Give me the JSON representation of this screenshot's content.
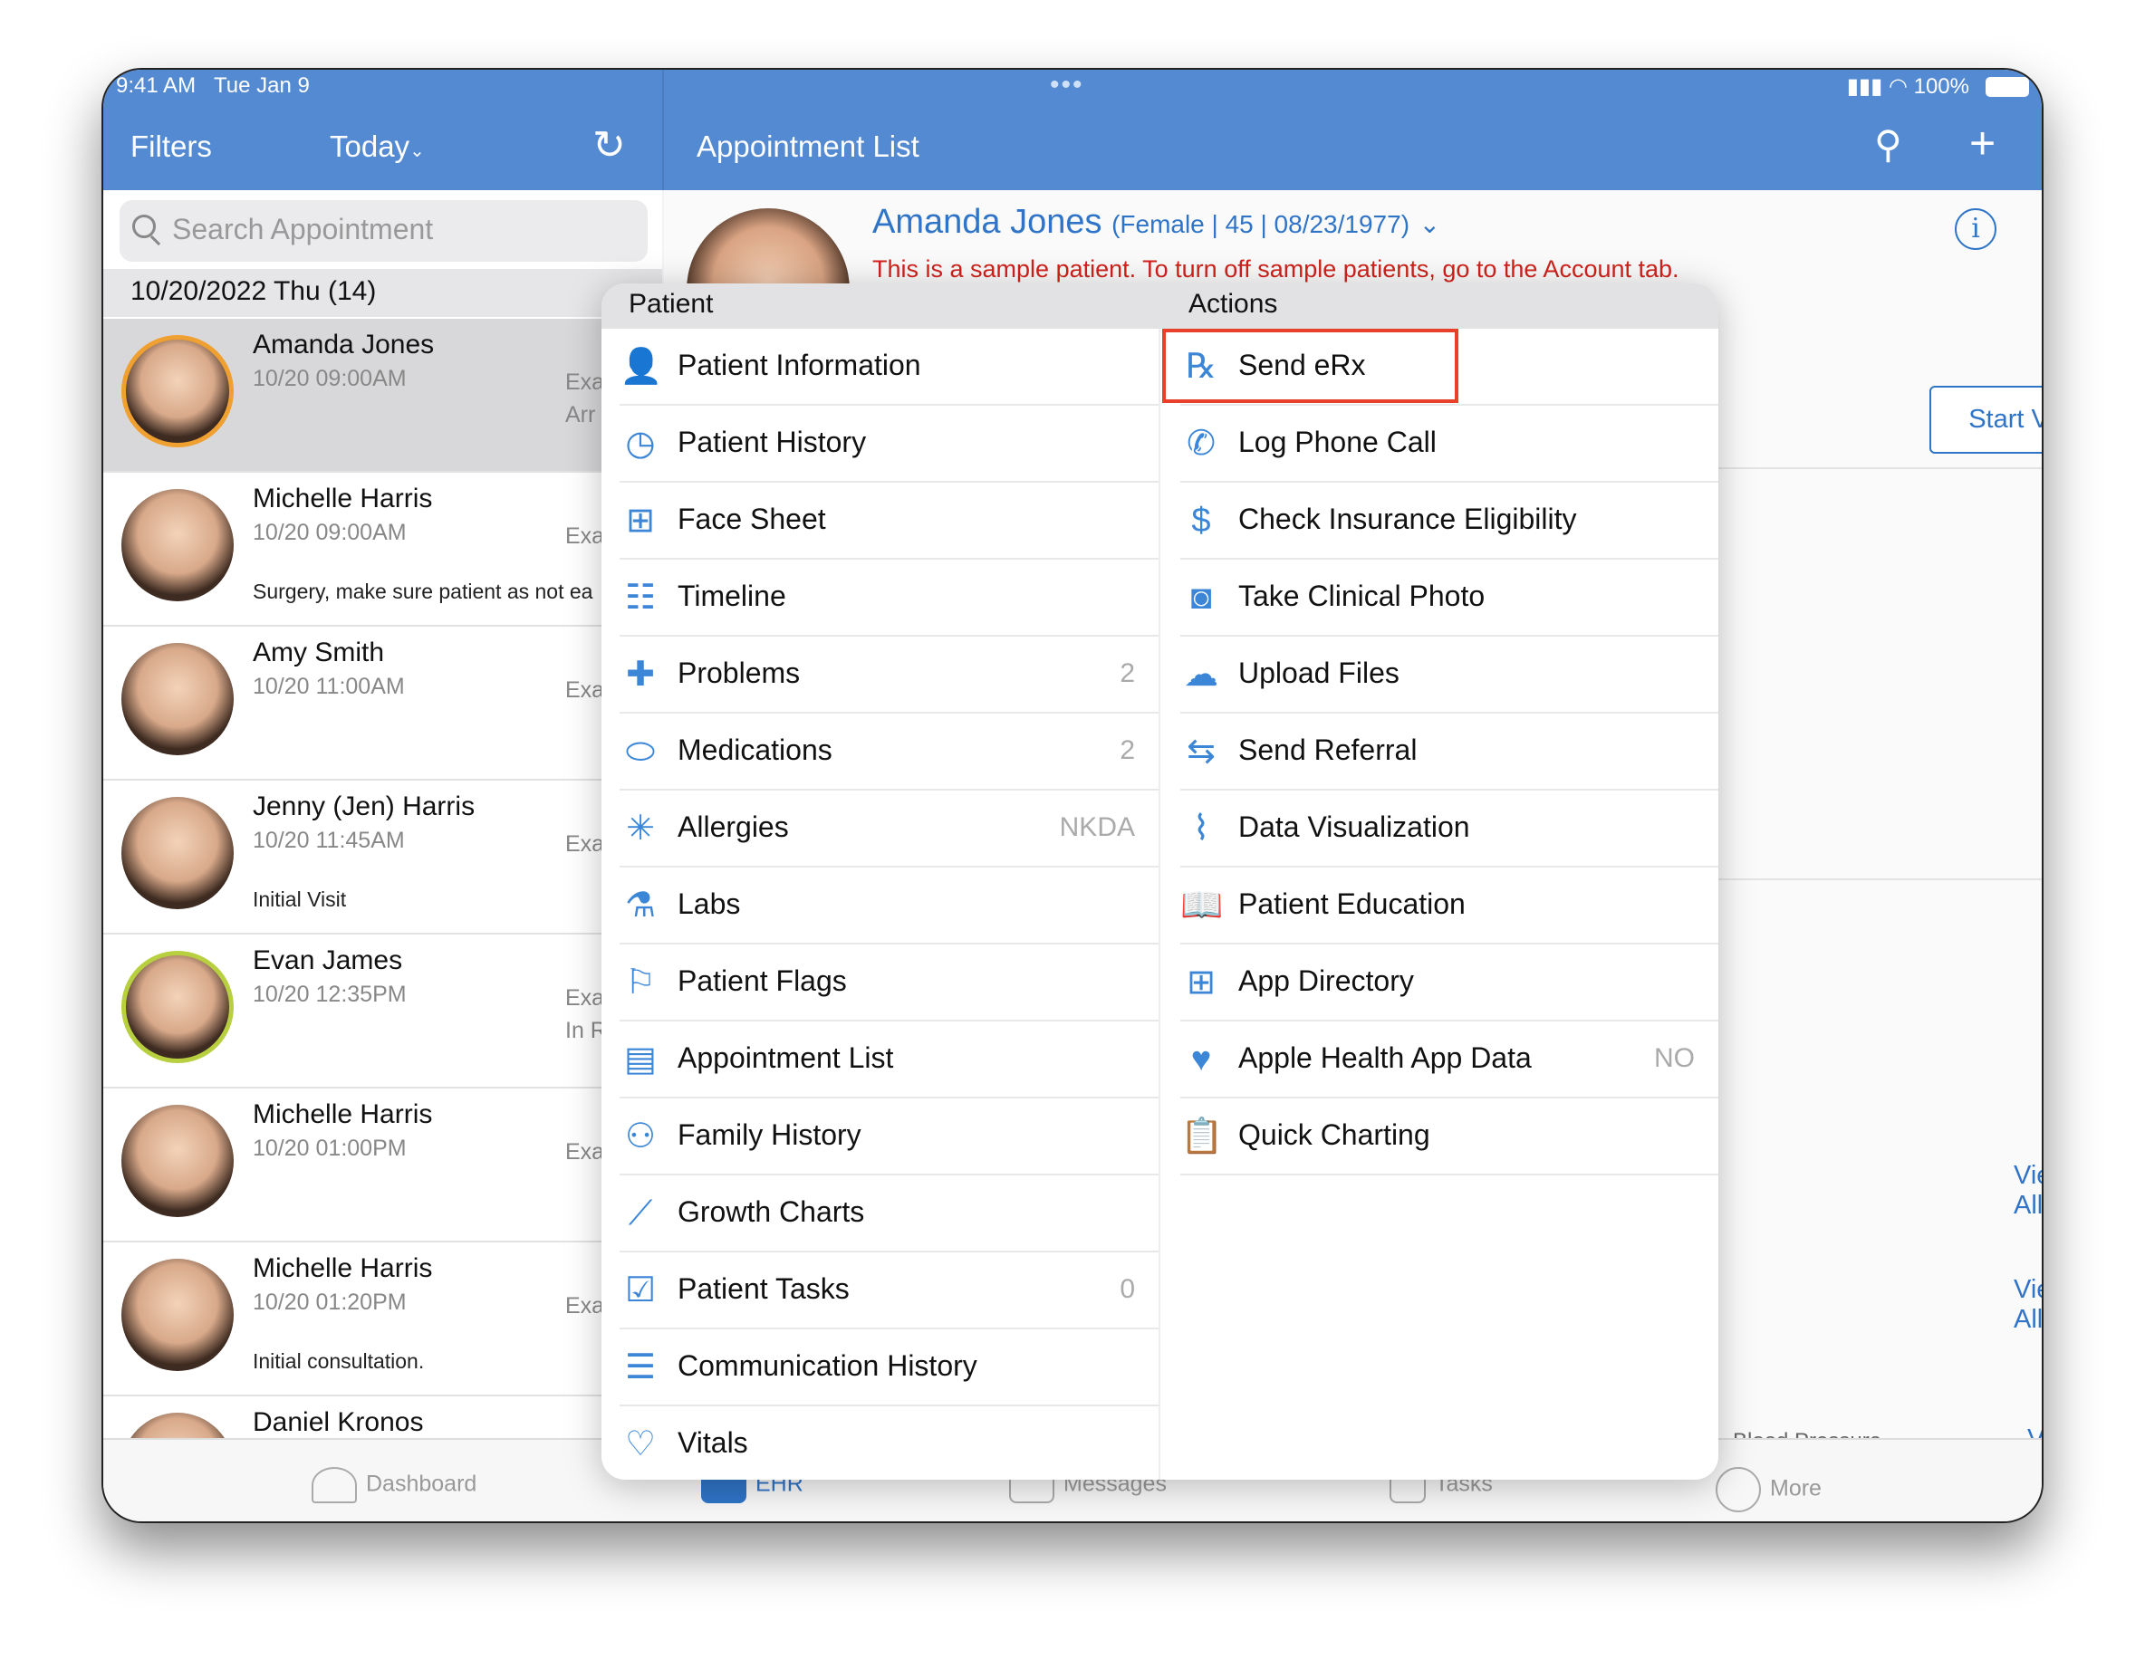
{
  "status": {
    "time": "9:41 AM",
    "date": "Tue Jan 9",
    "battery": "100%",
    "multitask_icon": "ellipsis-icon"
  },
  "left_nav": {
    "filters": "Filters",
    "today": "Today",
    "refresh_icon": "refresh-icon"
  },
  "right_nav": {
    "title": "Appointment List",
    "search_icon": "search-icon",
    "add_icon": "plus-icon"
  },
  "search": {
    "placeholder": "Search Appointment"
  },
  "date_header": "10/20/2022 Thu (14)",
  "appointments": [
    {
      "name": "Amanda Jones",
      "time": "10/20 09:00AM",
      "type": "Exa",
      "status": "Arr",
      "note": "",
      "ring": "#f0a030",
      "selected": true
    },
    {
      "name": "Michelle Harris",
      "time": "10/20 09:00AM",
      "type": "Exa",
      "status": "",
      "note": "Surgery, make sure patient as not ea"
    },
    {
      "name": "Amy Smith",
      "time": "10/20 11:00AM",
      "type": "Exa",
      "status": "",
      "note": ""
    },
    {
      "name": "Jenny (Jen) Harris",
      "time": "10/20 11:45AM",
      "type": "Exa",
      "status": "",
      "note": "Initial Visit"
    },
    {
      "name": "Evan James",
      "time": "10/20 12:35PM",
      "type": "Exa",
      "status": "In R",
      "note": "",
      "ring": "#b8d040"
    },
    {
      "name": "Michelle Harris",
      "time": "10/20 01:00PM",
      "type": "Exa",
      "status": "",
      "note": ""
    },
    {
      "name": "Michelle Harris",
      "time": "10/20 01:20PM",
      "type": "Exa",
      "status": "",
      "note": "Initial consultation."
    },
    {
      "name": "Daniel Kronos",
      "time": "",
      "type": "",
      "status": "",
      "note": ""
    }
  ],
  "patient": {
    "name": "Amanda Jones",
    "details": "(Female | 45 | 08/23/1977)",
    "warning": "This is a sample patient. To turn off sample patients, go to the Account tab.",
    "start_visit": "Start Visit"
  },
  "view_all": [
    "View All",
    "View All",
    "View All"
  ],
  "blood_pressure": "Blood Pressure",
  "popover": {
    "patient_header": "Patient",
    "actions_header": "Actions",
    "patient_items": [
      {
        "label": "Patient Information",
        "icon": "person-icon",
        "g": "👤",
        "badge": ""
      },
      {
        "label": "Patient History",
        "icon": "history-icon",
        "g": "◷",
        "badge": ""
      },
      {
        "label": "Face Sheet",
        "icon": "grid-icon",
        "g": "⊞",
        "badge": ""
      },
      {
        "label": "Timeline",
        "icon": "timeline-icon",
        "g": "☷",
        "badge": ""
      },
      {
        "label": "Problems",
        "icon": "medical-cross-icon",
        "g": "✚",
        "badge": "2"
      },
      {
        "label": "Medications",
        "icon": "pill-icon",
        "g": "⬭",
        "badge": "2"
      },
      {
        "label": "Allergies",
        "icon": "asterisk-icon",
        "g": "✳",
        "badge": "NKDA"
      },
      {
        "label": "Labs",
        "icon": "flask-icon",
        "g": "⚗",
        "badge": ""
      },
      {
        "label": "Patient Flags",
        "icon": "flag-icon",
        "g": "⚐",
        "badge": ""
      },
      {
        "label": "Appointment List",
        "icon": "calendar-clock-icon",
        "g": "▤",
        "badge": ""
      },
      {
        "label": "Family History",
        "icon": "family-tree-icon",
        "g": "⚇",
        "badge": ""
      },
      {
        "label": "Growth Charts",
        "icon": "chart-icon",
        "g": "⟋",
        "badge": ""
      },
      {
        "label": "Patient Tasks",
        "icon": "checklist-icon",
        "g": "☑",
        "badge": "0"
      },
      {
        "label": "Communication History",
        "icon": "chat-icon",
        "g": "☰",
        "badge": ""
      },
      {
        "label": "Vitals",
        "icon": "heart-pulse-icon",
        "g": "♡",
        "badge": ""
      }
    ],
    "action_items": [
      {
        "label": "Send eRx",
        "icon": "rx-icon",
        "g": "℞",
        "badge": ""
      },
      {
        "label": "Log Phone Call",
        "icon": "phone-icon",
        "g": "✆",
        "badge": ""
      },
      {
        "label": "Check Insurance Eligibility",
        "icon": "dollar-icon",
        "g": "$",
        "badge": ""
      },
      {
        "label": "Take Clinical Photo",
        "icon": "camera-icon",
        "g": "◙",
        "badge": ""
      },
      {
        "label": "Upload Files",
        "icon": "cloud-upload-icon",
        "g": "☁",
        "badge": ""
      },
      {
        "label": "Send Referral",
        "icon": "referral-icon",
        "g": "⇆",
        "badge": ""
      },
      {
        "label": "Data Visualization",
        "icon": "line-chart-icon",
        "g": "⌇",
        "badge": ""
      },
      {
        "label": "Patient Education",
        "icon": "book-icon",
        "g": "📖",
        "badge": ""
      },
      {
        "label": "App Directory",
        "icon": "apps-grid-icon",
        "g": "⊞",
        "badge": ""
      },
      {
        "label": "Apple Health App Data",
        "icon": "health-heart-icon",
        "g": "♥",
        "badge": "NO"
      },
      {
        "label": "Quick Charting",
        "icon": "clipboard-icon",
        "g": "📋",
        "badge": ""
      }
    ],
    "highlight_color": "#e8402a"
  },
  "tabs": [
    {
      "label": "Dashboard"
    },
    {
      "label": "EHR",
      "active": true
    },
    {
      "label": "Messages"
    },
    {
      "label": "Tasks"
    },
    {
      "label": "More"
    }
  ]
}
